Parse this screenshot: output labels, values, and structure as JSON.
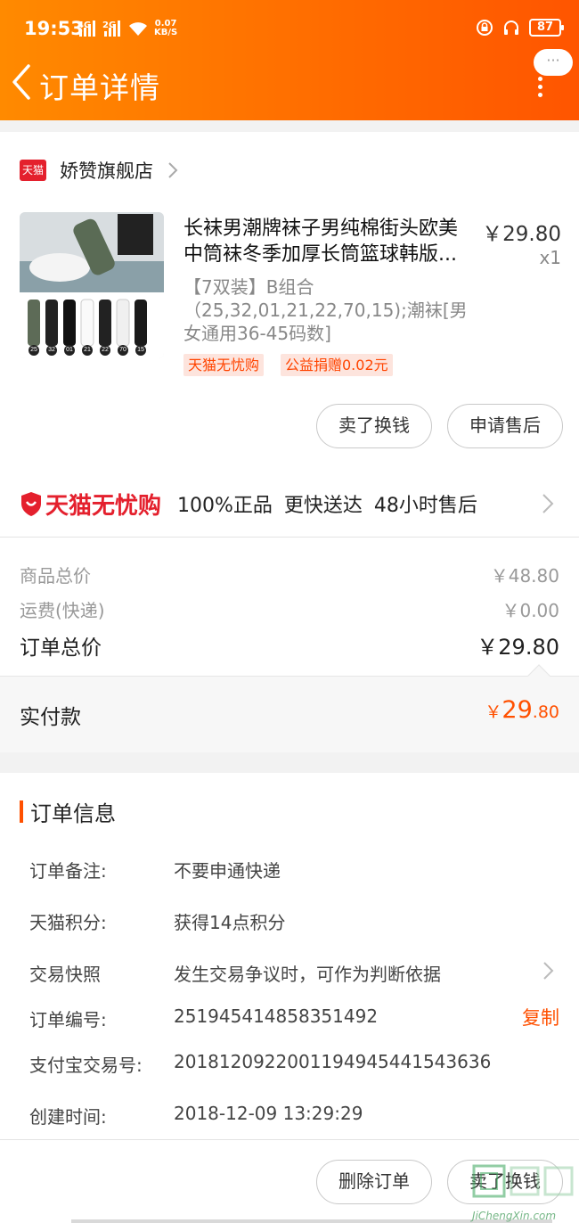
{
  "status_bar": {
    "time": "19:53",
    "sig1": "4G",
    "sig2": "2G",
    "speed_value": "0.07",
    "speed_unit": "KB/S",
    "battery": "87"
  },
  "header": {
    "title": "订单详情",
    "more_label": "···"
  },
  "store": {
    "logo_text": "天猫",
    "name": "娇赞旗舰店"
  },
  "product": {
    "title": "长袜男潮牌袜子男纯棉街头欧美中筒袜冬季加厚长筒篮球韩版...",
    "price": "￥29.80",
    "quantity": "x1",
    "sku": "【7双装】B组合（25,32,01,21,22,70,15);潮袜[男女通用36-45码数]",
    "tags": [
      "天猫无忧购",
      "公益捐赠0.02元"
    ],
    "sock_numbers": [
      "25",
      "32",
      "01",
      "21",
      "22",
      "70",
      "15"
    ]
  },
  "item_actions": {
    "sell_label": "卖了换钱",
    "aftersale_label": "申请售后"
  },
  "worry_free": {
    "brand": "天猫无忧购",
    "features": "100%正品 更快送达 48小时售后"
  },
  "summary": {
    "goods_label": "商品总价",
    "goods_value": "￥48.80",
    "shipping_label": "运费(快递)",
    "shipping_value": "￥0.00",
    "total_label": "订单总价",
    "total_value": "￥29.80",
    "paid_label": "实付款",
    "paid_currency": "￥",
    "paid_int": "29",
    "paid_dec": ".80"
  },
  "order_info": {
    "title": "订单信息",
    "rows": [
      {
        "key": "订单备注:",
        "value": "不要申通快递"
      },
      {
        "key": "天猫积分:",
        "value": "获得14点积分"
      },
      {
        "key": "交易快照",
        "value": "发生交易争议时，可作为判断依据"
      },
      {
        "key": "订单编号:",
        "value": "251945414858351492"
      },
      {
        "key": "支付宝交易号:",
        "value": "2018120922001194945441543636"
      },
      {
        "key": "创建时间:",
        "value": "2018-12-09 13:29:29"
      }
    ],
    "copy_label": "复制"
  },
  "bottom_actions": {
    "delete_label": "删除订单",
    "sell_label": "卖了换钱"
  },
  "watermark": {
    "text": "JiChengXin.com"
  },
  "colors": {
    "brand_orange": "#ff6a00",
    "accent": "#ff5000",
    "tmall_red": "#e4202d"
  }
}
